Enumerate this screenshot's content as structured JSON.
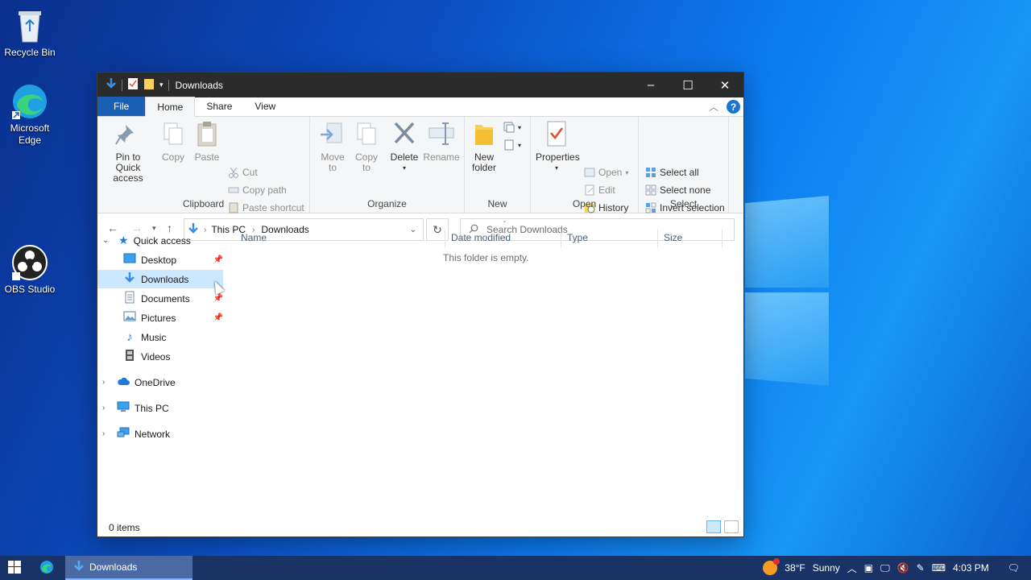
{
  "desktop": {
    "icons": [
      {
        "label": "Recycle Bin",
        "icon": "recycle-bin-icon"
      },
      {
        "label": "Microsoft\nEdge",
        "icon": "edge-icon"
      },
      {
        "label": "OBS Studio",
        "icon": "obs-icon"
      }
    ]
  },
  "window": {
    "title": "Downloads",
    "tabs": [
      "File",
      "Home",
      "Share",
      "View"
    ],
    "active_tab": "Home",
    "ribbon": {
      "clipboard": {
        "label": "Clipboard",
        "pin": "Pin to Quick\naccess",
        "copy": "Copy",
        "paste": "Paste",
        "cut": "Cut",
        "copy_path": "Copy path",
        "paste_shortcut": "Paste shortcut"
      },
      "organize": {
        "label": "Organize",
        "move_to": "Move\nto",
        "copy_to": "Copy\nto",
        "delete": "Delete",
        "rename": "Rename"
      },
      "new": {
        "label": "New",
        "new_folder": "New\nfolder"
      },
      "open": {
        "label": "Open",
        "properties": "Properties",
        "open": "Open",
        "edit": "Edit",
        "history": "History"
      },
      "select": {
        "label": "Select",
        "select_all": "Select all",
        "select_none": "Select none",
        "invert": "Invert selection"
      }
    },
    "address": {
      "segments": [
        "This PC",
        "Downloads"
      ]
    },
    "search": {
      "placeholder": "Search Downloads"
    },
    "nav": {
      "quick_access": "Quick access",
      "items": [
        {
          "label": "Desktop",
          "pinned": true
        },
        {
          "label": "Downloads",
          "pinned": true
        },
        {
          "label": "Documents",
          "pinned": true
        },
        {
          "label": "Pictures",
          "pinned": true
        },
        {
          "label": "Music",
          "pinned": false
        },
        {
          "label": "Videos",
          "pinned": false
        }
      ],
      "onedrive": "OneDrive",
      "this_pc": "This PC",
      "network": "Network"
    },
    "columns": [
      "Name",
      "Date modified",
      "Type",
      "Size"
    ],
    "empty_message": "This folder is empty.",
    "status": "0 items"
  },
  "taskbar": {
    "active_task": "Downloads",
    "weather_temp": "38°F",
    "weather_cond": "Sunny",
    "time": "4:03 PM"
  },
  "colors": {
    "accent": "#1a5fb4",
    "selection": "#cce8ff",
    "titlebar": "#2b2b2b",
    "taskbar": "#1a3366"
  }
}
